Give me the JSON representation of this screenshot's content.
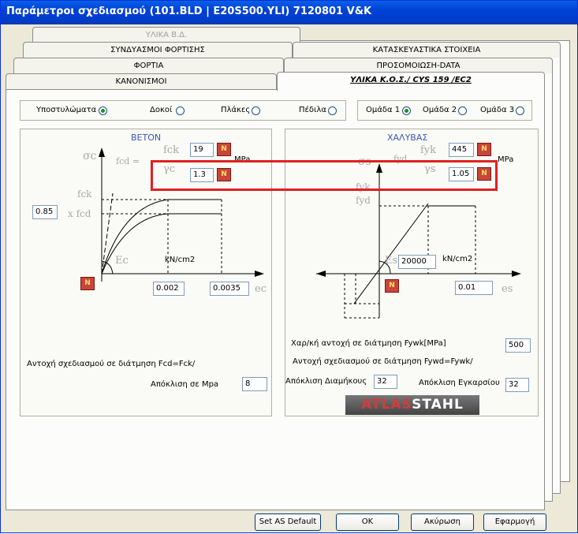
{
  "title": "Παράμετροι σχεδιασμού (101.BLD | E20S500.YLI) 7120801  V&K",
  "tabs": {
    "row1": [
      "ΥΛΙΚΑ Β.Δ."
    ],
    "row2": [
      "ΣΥΝΔΥΑΣΜΟΙ ΦΟΡΤΙΣΗΣ",
      "ΚΑΤΑΣΚΕΥΑΣΤΙΚΑ ΣΤΟΙΧΕΙΑ"
    ],
    "row3": [
      "ΦΟΡΤΙΑ",
      "ΠΡΟΣΟΜΟΙΩΣΗ-DATA"
    ],
    "row4": [
      "ΚΑΝΟΝΙΣΜΟΙ",
      "ΥΛΙΚΑ Κ.Ο.Σ./ CYS 159 /EC2"
    ]
  },
  "members": {
    "items": [
      {
        "label": "Υποστυλώματα",
        "checked": true
      },
      {
        "label": "Δοκοί",
        "checked": false
      },
      {
        "label": "Πλάκες",
        "checked": false
      },
      {
        "label": "Πέδιλα",
        "checked": false
      }
    ]
  },
  "groups": {
    "items": [
      {
        "label": "Ομάδα 1",
        "checked": true
      },
      {
        "label": "Ομάδα 2",
        "checked": false
      },
      {
        "label": "Ομάδα 3",
        "checked": false
      }
    ]
  },
  "concrete": {
    "heading": "BETON",
    "fck": "19",
    "fck_unit": "MPa",
    "gamma_c": "1.3",
    "alpha": "0.85",
    "eps1": "0.002",
    "eps2": "0.0035",
    "modulus_unit": "kN/cm2",
    "sym_sigma": "σc",
    "sym_fcd_eq": "fcd =",
    "sym_fck": "fck",
    "sym_gc": "γc",
    "sym_fck_axis": "fck",
    "sym_xfcd": "x fcd",
    "sym_Ec": "Ec",
    "sym_ec": "ec",
    "shear_text": "Αντοχή σχεδιασμού σε διάτμηση Fcd=Fck/",
    "deviation_label": "Απόκλιση σε Mpa",
    "deviation_value": "8"
  },
  "steel": {
    "heading": "ΧΑΛΥΒΑΣ",
    "fyk": "445",
    "fyk_unit": "MPa",
    "gamma_s": "1.05",
    "Es": "20000",
    "Es_unit": "kN/cm2",
    "eps_s": "0.01",
    "sym_sigma": "σs",
    "sym_fyd_eq": "fyd",
    "sym_fyk": "fyk",
    "sym_gs": "γs",
    "sym_fyk_axis": "fyk",
    "sym_fyd_axis": "fyd",
    "sym_Es": "Es",
    "sym_es": "es",
    "char_strength_label": "Χαρ/κή αντοχή σε διάτμηση Fywk[MPa]",
    "char_strength_value": "500",
    "design_shear_text": "Αντοχή σχεδιασμού σε διάτμηση Fywd=Fywk/",
    "long_label": "Απόκλιση Διαμήκους",
    "long_value": "32",
    "trans_label": "Απόκλιση Εγκαρσίου",
    "trans_value": "32",
    "logo_a": "ATLAS",
    "logo_b": "STAHL"
  },
  "icon_text": "N",
  "buttons": {
    "default": "Set AS Default",
    "ok": "OK",
    "cancel": "Ακύρωση",
    "apply": "Εφαρμογή"
  }
}
